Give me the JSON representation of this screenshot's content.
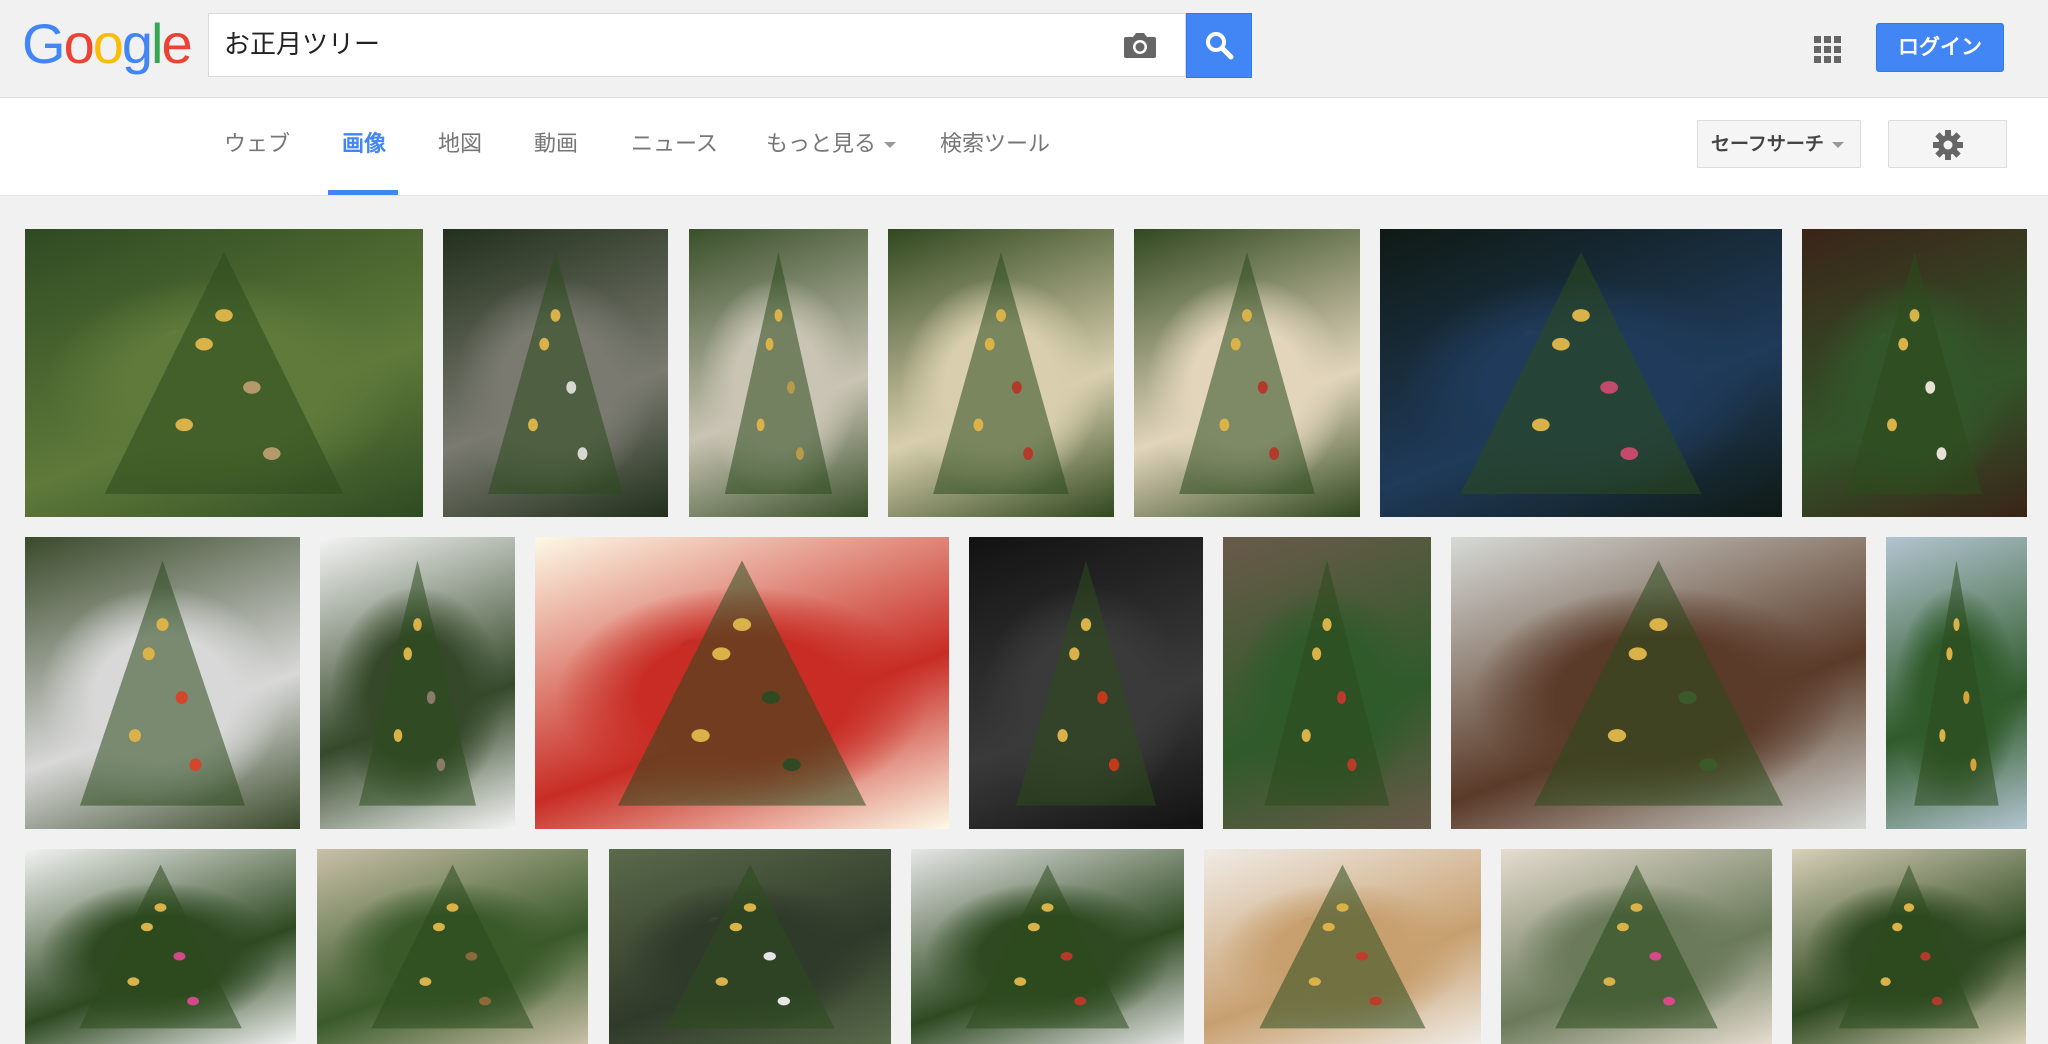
{
  "header": {
    "logo_letters": [
      {
        "ch": "G",
        "color": "#4285f4"
      },
      {
        "ch": "o",
        "color": "#ea4335"
      },
      {
        "ch": "o",
        "color": "#fbbc05"
      },
      {
        "ch": "g",
        "color": "#4285f4"
      },
      {
        "ch": "l",
        "color": "#34a853"
      },
      {
        "ch": "e",
        "color": "#ea4335"
      }
    ],
    "search_query": "お正月ツリー",
    "camera_icon": "camera-icon",
    "search_icon": "search-icon",
    "apps_icon": "apps-grid-icon",
    "login_label": "ログイン"
  },
  "nav": {
    "tabs": [
      {
        "label": "ウェブ",
        "active": false
      },
      {
        "label": "画像",
        "active": true
      },
      {
        "label": "地図",
        "active": false
      },
      {
        "label": "動画",
        "active": false
      },
      {
        "label": "ニュース",
        "active": false
      },
      {
        "label": "もっと見る",
        "active": false,
        "dropdown": true
      },
      {
        "label": "検索ツール",
        "active": false
      }
    ],
    "safesearch_label": "セーフサーチ",
    "settings_icon": "gear-icon",
    "accent_color": "#4285f4"
  },
  "results": {
    "rows": [
      [
        {
          "tones": [
            "#2f4a22",
            "#5f7a3a",
            "#b49a6a"
          ]
        },
        {
          "tones": [
            "#22301c",
            "#7a7a70",
            "#d8d8d2"
          ]
        },
        {
          "tones": [
            "#39502a",
            "#c9c4b4",
            "#b99a4a"
          ]
        },
        {
          "tones": [
            "#30481f",
            "#d9cfae",
            "#b33a2a"
          ]
        },
        {
          "tones": [
            "#30481f",
            "#e2d5bc",
            "#b33a2a"
          ]
        },
        {
          "tones": [
            "#0f1a14",
            "#1f3a5a",
            "#c44a6a"
          ]
        },
        {
          "tones": [
            "#3a2418",
            "#33552a",
            "#e8e2d6"
          ]
        }
      ],
      [
        {
          "tones": [
            "#3a4a2a",
            "#d8d8d8",
            "#d2472a"
          ]
        },
        {
          "tones": [
            "#f4f4f4",
            "#35492a",
            "#8a7a6a"
          ]
        },
        {
          "tones": [
            "#fdf9e6",
            "#c82c24",
            "#2f4a22"
          ]
        },
        {
          "tones": [
            "#121212",
            "#3a3a3a",
            "#c23a1a"
          ]
        },
        {
          "tones": [
            "#6a5a4a",
            "#2f5a2a",
            "#b83a2a"
          ]
        },
        {
          "tones": [
            "#d6dad6",
            "#5a3a28",
            "#3a5a2a"
          ]
        },
        {
          "tones": [
            "#b2c4d0",
            "#2f5a2a",
            "#d6a23a"
          ]
        }
      ],
      [
        {
          "tones": [
            "#f2f2f2",
            "#2f4a22",
            "#d24a8a"
          ]
        },
        {
          "tones": [
            "#c9c0a8",
            "#3a5a2a",
            "#8a6a3a"
          ]
        },
        {
          "tones": [
            "#5a6a4a",
            "#2f3a2a",
            "#e6e6e6"
          ]
        },
        {
          "tones": [
            "#e6e6e6",
            "#2f4a22",
            "#b33a2a"
          ]
        },
        {
          "tones": [
            "#f0ece6",
            "#c8a070",
            "#c23a2a"
          ]
        },
        {
          "tones": [
            "#e6dcd0",
            "#6a7a5a",
            "#d64a8a"
          ]
        },
        {
          "tones": [
            "#d8d0b8",
            "#2f4a22",
            "#b33a2a"
          ]
        }
      ]
    ]
  }
}
